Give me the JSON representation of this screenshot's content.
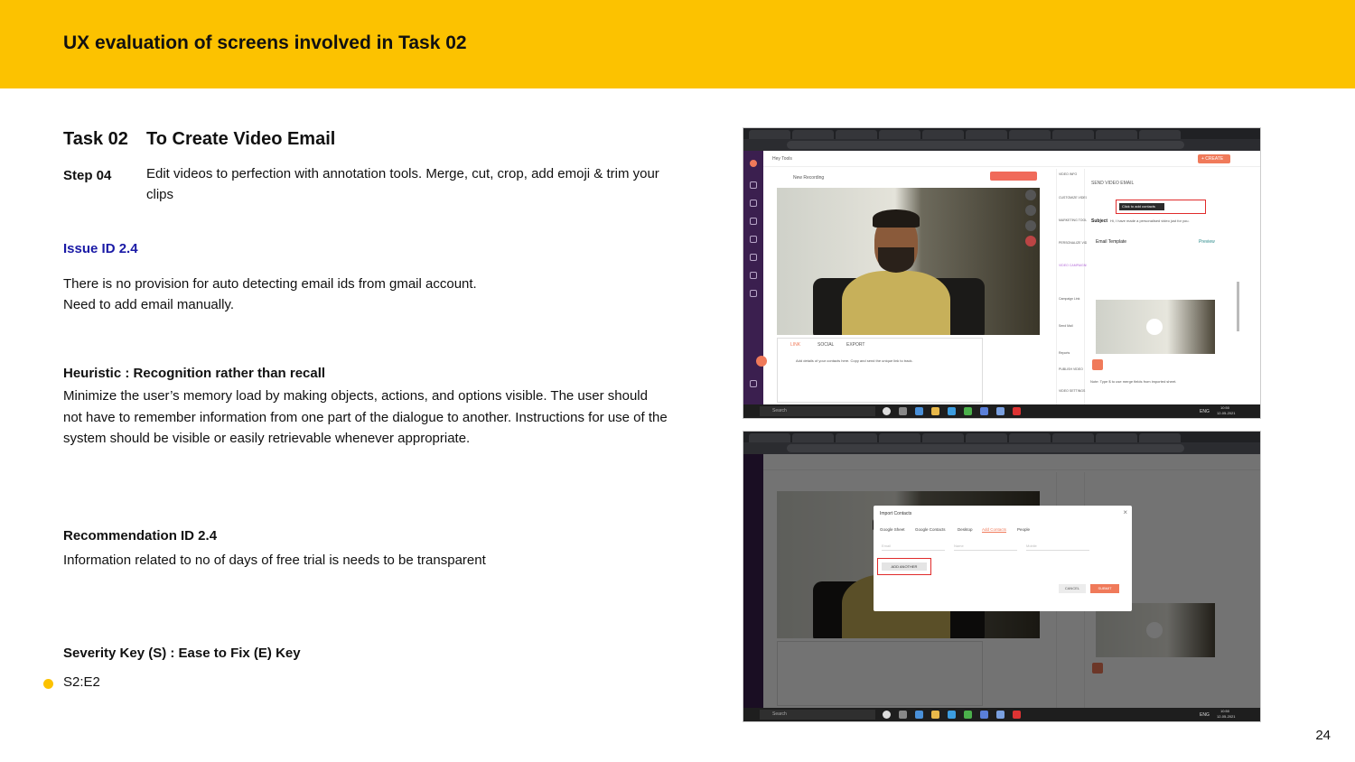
{
  "header": {
    "title": "UX evaluation of screens involved in Task 02"
  },
  "task": {
    "label": "Task 02",
    "title": "To Create Video Email"
  },
  "step": {
    "label": "Step 04",
    "text": "Edit videos to perfection with annotation tools. Merge, cut, crop, add emoji & trim your clips"
  },
  "issue": {
    "id": "Issue ID 2.4",
    "lines": [
      "There is no provision for auto detecting email ids from gmail account.",
      "Need to add email manually."
    ]
  },
  "heuristic": {
    "title": "Heuristic : Recognition rather than recall",
    "text": "Minimize the user’s memory load by making objects, actions, and options visible. The user should not have to remember information from one part of the dialogue to another. Instructions for use of the system should be visible or easily retrievable whenever appropriate."
  },
  "recommendation": {
    "title": "Recommendation ID 2.4",
    "text": "Information related to no of days of free trial is needs to be transparent"
  },
  "severity": {
    "title": "Severity Key (S) : Ease to Fix (E) Key",
    "value": "S2:E2",
    "dot_color": "#fcc200"
  },
  "page_number": "24",
  "screenshot1": {
    "logo_text": "Hey Tools",
    "new_recording": "New Recording",
    "send_video_email": "SEND VIDEO EMAIL",
    "click_to_add": "Click to add contacts",
    "subject_label": "Subject",
    "subject_text": "Hi, I have made a personalised video just for you.",
    "email_template": "Email Template",
    "preview": "Preview",
    "create": "+ CREATE",
    "search": "Search",
    "time": "10:50",
    "date": "12-05-2021",
    "lang": "ENG",
    "share_tabs": [
      "LINK",
      "SOCIAL",
      "EXPORT"
    ],
    "share_hint": "Add details of your contacts here. Copy and send the unique link to track.",
    "side_items": [
      "VIDEO INFO",
      "CUSTOMIZE VIDEO",
      "MARKETING TOOLS",
      "PERSONALIZE VIDEO",
      "VIDEO CAMPAIGNS",
      "Campaign Link",
      "Send Mail",
      "Reports",
      "PUBLISH VIDEO",
      "VIDEO SETTINGS"
    ],
    "footer_note": "Note: Type $ to use merge fields from imported sheet."
  },
  "screenshot2": {
    "modal_title": "Import Contacts",
    "modal_close": "×",
    "tabs": [
      "Google Sheet",
      "Google Contacts",
      "Desktop",
      "Add Contacts",
      "People"
    ],
    "fields": [
      "Email",
      "Name",
      "Mobile"
    ],
    "add_another": "ADD ANOTHER",
    "cancel": "CANCEL",
    "submit": "SUBMIT",
    "search": "Search",
    "time": "10:50",
    "date": "12-05-2021",
    "lang": "ENG"
  },
  "colors": {
    "accent": "#fcc200",
    "issue_blue": "#1a1aa6",
    "app_orange": "#f07a5a",
    "app_purple": "#3b1f4f"
  }
}
